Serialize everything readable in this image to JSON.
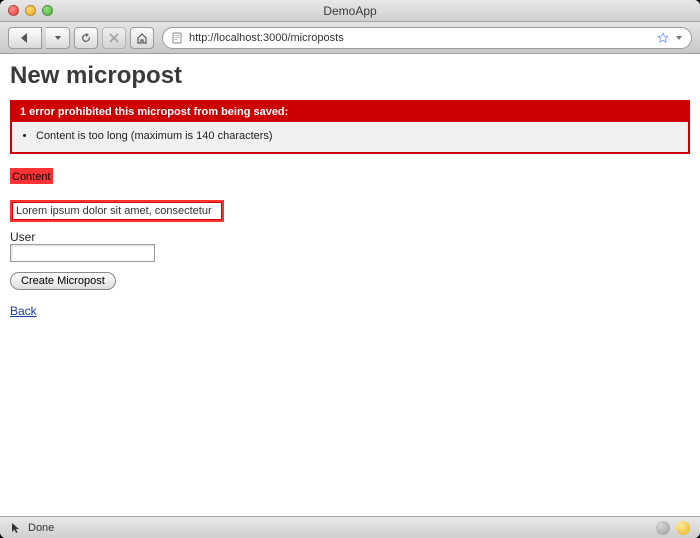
{
  "window": {
    "title": "DemoApp"
  },
  "toolbar": {
    "url": "http://localhost:3000/microposts"
  },
  "page": {
    "heading": "New micropost"
  },
  "errors": {
    "header": "1 error prohibited this micropost from being saved:",
    "items": [
      "Content is too long (maximum is 140 characters)"
    ]
  },
  "form": {
    "content_label": "Content",
    "content_value": "Lorem ipsum dolor sit amet, consectetur",
    "user_label": "User",
    "user_value": "",
    "submit_label": "Create Micropost"
  },
  "links": {
    "back": "Back"
  },
  "status": {
    "text": "Done"
  }
}
